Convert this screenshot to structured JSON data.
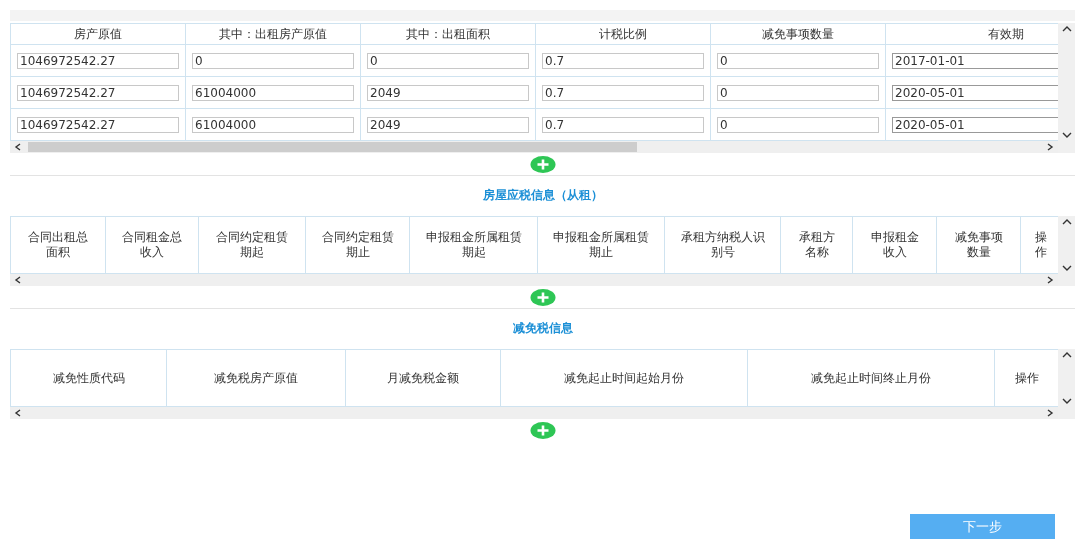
{
  "property_table": {
    "columns": [
      "房产原值",
      "其中：出租房产原值",
      "其中：出租面积",
      "计税比例",
      "减免事项数量",
      "有效期"
    ],
    "rows": [
      [
        "1046972542.27",
        "0",
        "0",
        "0.7",
        "0",
        "2017-01-01"
      ],
      [
        "1046972542.27",
        "61004000",
        "2049",
        "0.7",
        "0",
        "2020-05-01"
      ],
      [
        "1046972542.27",
        "61004000",
        "2049",
        "0.7",
        "0",
        "2020-05-01"
      ]
    ]
  },
  "rental_section": {
    "title": "房屋应税信息（从租）",
    "columns": [
      "合同出租总面积",
      "合同租金总收入",
      "合同约定租赁期起",
      "合同约定租赁期止",
      "申报租金所属租赁期起",
      "申报租金所属租赁期止",
      "承租方纳税人识别号",
      "承租方名称",
      "申报租金收入",
      "减免事项数量",
      "操作"
    ]
  },
  "exemption_section": {
    "title": "减免税信息",
    "columns": [
      "减免性质代码",
      "减免税房产原值",
      "月减免税金额",
      "减免起止时间起始月份",
      "减免起止时间终止月份",
      "操作"
    ]
  },
  "next_button": "下一步"
}
